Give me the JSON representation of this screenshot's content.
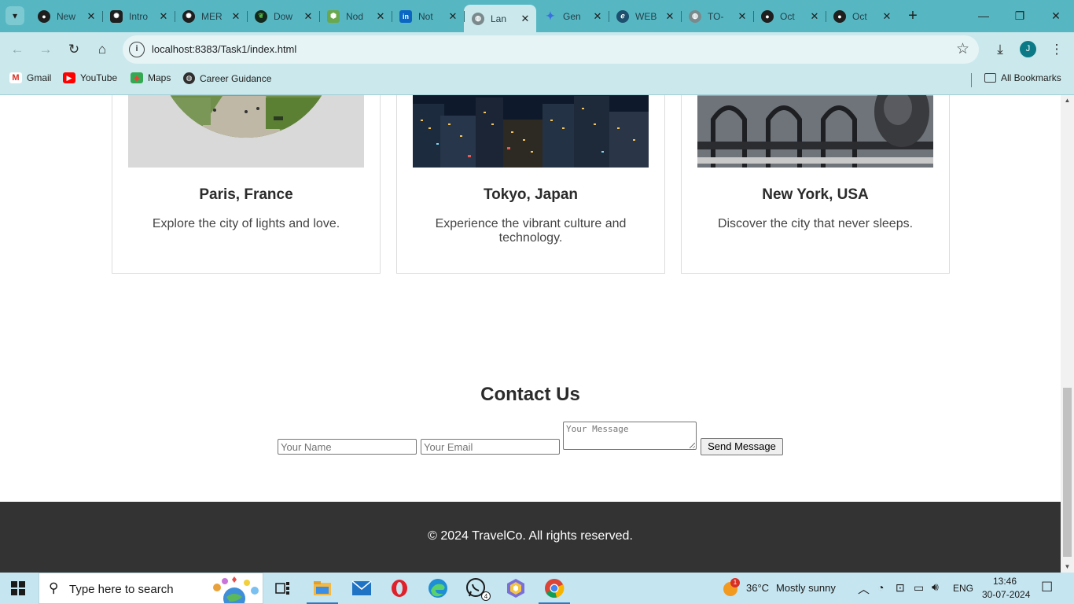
{
  "browser": {
    "tabs": [
      {
        "title": "New",
        "favicon": "github-icon",
        "active": false
      },
      {
        "title": "Intro",
        "favicon": "chatgpt-icon",
        "active": false
      },
      {
        "title": "MER",
        "favicon": "chatgpt-icon",
        "active": false
      },
      {
        "title": "Dow",
        "favicon": "mongodb-icon",
        "active": false
      },
      {
        "title": "Nod",
        "favicon": "nodejs-icon",
        "active": false
      },
      {
        "title": "Not",
        "favicon": "linkedin-icon",
        "active": false
      },
      {
        "title": "Lan",
        "favicon": "globe-icon",
        "active": true
      },
      {
        "title": "Gen",
        "favicon": "gemini-icon",
        "active": false
      },
      {
        "title": "WEB",
        "favicon": "edge-icon",
        "active": false
      },
      {
        "title": "TO-",
        "favicon": "globe-icon",
        "active": false
      },
      {
        "title": "Oct",
        "favicon": "github-icon",
        "active": false
      },
      {
        "title": "Oct",
        "favicon": "github-icon",
        "active": false
      }
    ],
    "url": "localhost:8383/Task1/index.html",
    "profile_initial": "J",
    "bookmarks": [
      {
        "label": "Gmail",
        "icon": "gmail-icon"
      },
      {
        "label": "YouTube",
        "icon": "youtube-icon"
      },
      {
        "label": "Maps",
        "icon": "maps-icon"
      },
      {
        "label": "Career Guidance",
        "icon": "globe-icon"
      }
    ],
    "all_bookmarks_label": "All Bookmarks"
  },
  "page": {
    "destinations": [
      {
        "title": "Paris, France",
        "description": "Explore the city of lights and love."
      },
      {
        "title": "Tokyo, Japan",
        "description": "Experience the vibrant culture and technology."
      },
      {
        "title": "New York, USA",
        "description": "Discover the city that never sleeps."
      }
    ],
    "contact": {
      "heading": "Contact Us",
      "name_placeholder": "Your Name",
      "email_placeholder": "Your Email",
      "message_placeholder": "Your Message",
      "submit_label": "Send Message"
    },
    "footer": "© 2024 TravelCo. All rights reserved."
  },
  "taskbar": {
    "search_placeholder": "Type here to search",
    "whatsapp_badge": "4",
    "weather_badge": "1",
    "temperature": "36°C",
    "weather": "Mostly sunny",
    "language": "ENG",
    "time": "13:46",
    "date": "30-07-2024"
  },
  "colors": {
    "tab_strip": "#56b7c3",
    "toolbar": "#cbe9ec",
    "footer": "#333333",
    "taskbar": "#c5e5f0"
  }
}
